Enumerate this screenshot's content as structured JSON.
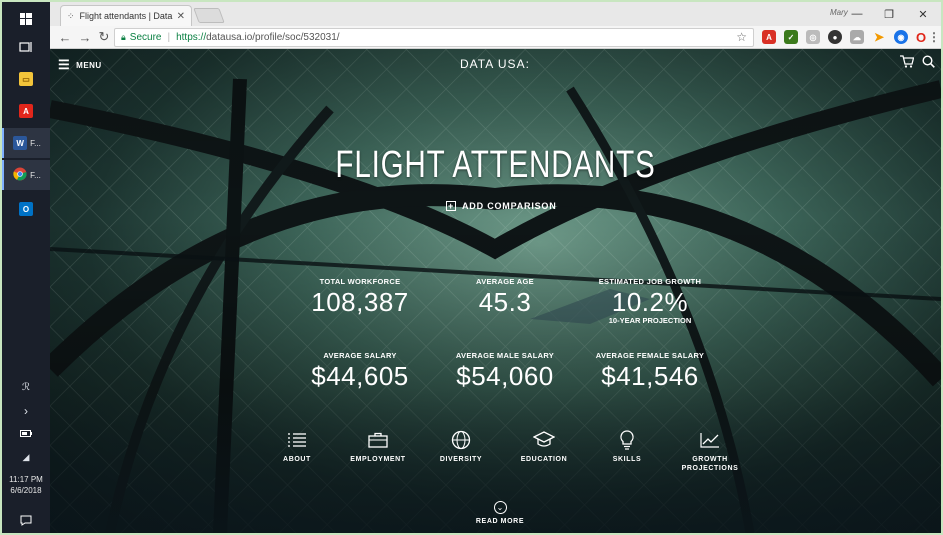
{
  "taskbar": {
    "items": [
      {
        "icon": "windows-start-icon",
        "label": ""
      },
      {
        "icon": "task-view-icon",
        "label": ""
      },
      {
        "icon": "file-explorer-icon",
        "label": ""
      },
      {
        "icon": "acrobat-icon",
        "label": ""
      },
      {
        "icon": "word-icon",
        "label": "F..."
      },
      {
        "icon": "chrome-icon",
        "label": "F..."
      },
      {
        "icon": "outlook-icon",
        "label": ""
      }
    ],
    "time": "11:17 PM",
    "date": "6/6/2018"
  },
  "browser": {
    "tab_title": "Flight attendants | Data U",
    "user": "Mary",
    "secure_label": "Secure",
    "url_scheme": "https://",
    "url_rest": "datausa.io/profile/soc/532031/"
  },
  "page": {
    "menu_label": "MENU",
    "logo": "DATA USA:",
    "title": "FLIGHT ATTENDANTS",
    "add_comparison": "ADD COMPARISON",
    "stats": [
      {
        "label": "TOTAL WORKFORCE",
        "value": "108,387",
        "sub": ""
      },
      {
        "label": "AVERAGE AGE",
        "value": "45.3",
        "sub": ""
      },
      {
        "label": "ESTIMATED JOB GROWTH",
        "value": "10.2%",
        "sub": "10-YEAR PROJECTION"
      },
      {
        "label": "AVERAGE SALARY",
        "value": "$44,605",
        "sub": ""
      },
      {
        "label": "AVERAGE MALE SALARY",
        "value": "$54,060",
        "sub": ""
      },
      {
        "label": "AVERAGE FEMALE SALARY",
        "value": "$41,546",
        "sub": ""
      }
    ],
    "sections": [
      {
        "label": "ABOUT",
        "icon": "list-icon"
      },
      {
        "label": "EMPLOYMENT",
        "icon": "briefcase-icon"
      },
      {
        "label": "DIVERSITY",
        "icon": "globe-icon"
      },
      {
        "label": "EDUCATION",
        "icon": "graduation-cap-icon"
      },
      {
        "label": "SKILLS",
        "icon": "lightbulb-icon"
      },
      {
        "label": "GROWTH",
        "label2": "PROJECTIONS",
        "icon": "line-chart-icon"
      }
    ],
    "read_more": "READ MORE"
  }
}
